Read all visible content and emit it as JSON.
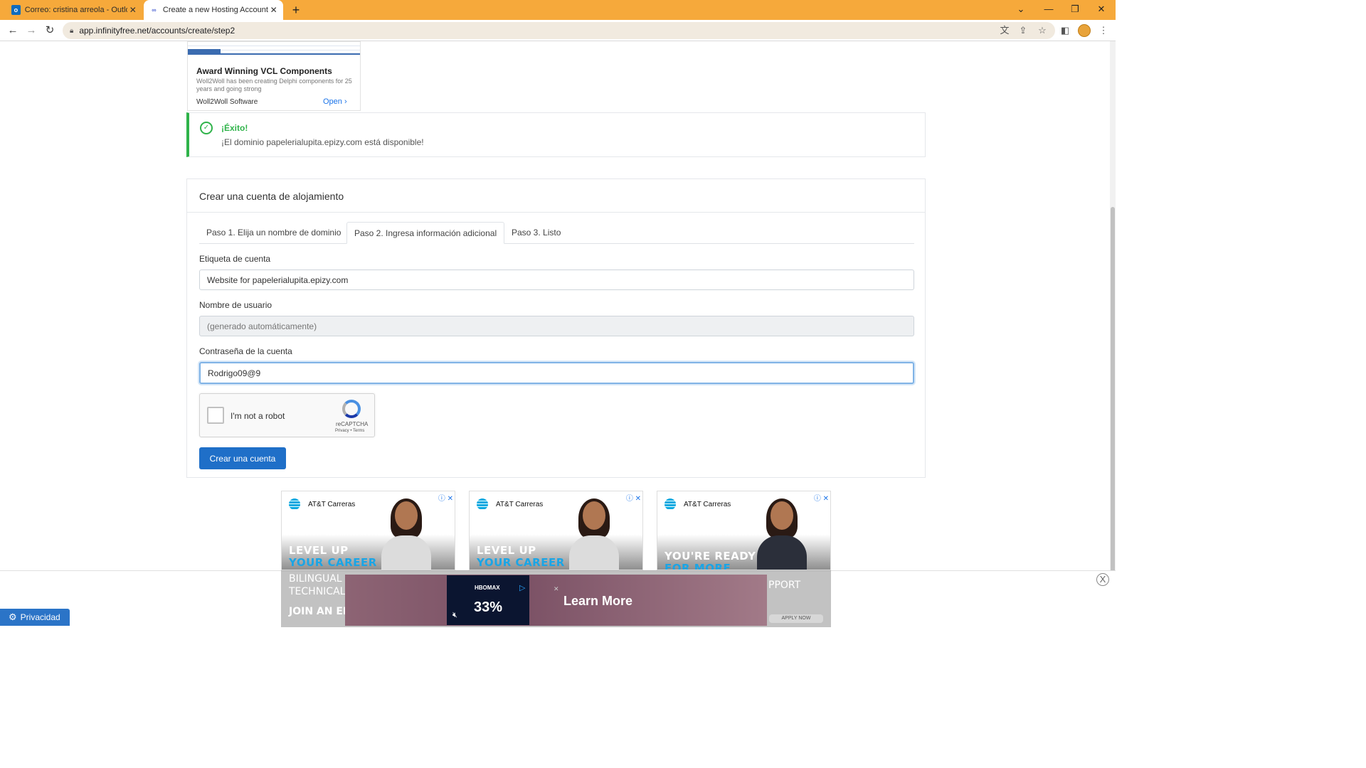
{
  "browser": {
    "tabs": [
      {
        "title": "Correo: cristina arreola - Outlook",
        "icon": "outlook-icon",
        "active": false
      },
      {
        "title": "Create a new Hosting Account - I",
        "icon": "infinityfree-icon",
        "active": true
      }
    ],
    "url": "app.infinityfree.net/accounts/create/step2",
    "accent_color": "#f6a93b"
  },
  "top_ad": {
    "title": "Award Winning VCL Components",
    "description": "Woll2Woll has been creating Delphi components for 25 years and going strong",
    "brand": "Woll2Woll Software",
    "cta": "Open"
  },
  "alert": {
    "title": "¡Éxito!",
    "message": "¡El dominio papelerialupita.epizy.com está disponible!",
    "color": "#2fb34a"
  },
  "card": {
    "title": "Crear una cuenta de alojamiento",
    "tabs": [
      {
        "label": "Paso 1. Elija un nombre de dominio",
        "active": false
      },
      {
        "label": "Paso 2. Ingresa información adicional",
        "active": true
      },
      {
        "label": "Paso 3. Listo",
        "active": false
      }
    ],
    "fields": {
      "account_label": {
        "label": "Etiqueta de cuenta",
        "value": "Website for papelerialupita.epizy.com"
      },
      "username": {
        "label": "Nombre de usuario",
        "placeholder": "(generado automáticamente)"
      },
      "password": {
        "label": "Contraseña de la cuenta",
        "value": "Rodrigo09@9"
      }
    },
    "captcha": {
      "label": "I'm not a robot",
      "brand": "reCAPTCHA",
      "terms": "Privacy • Terms"
    },
    "submit_label": "Crear una cuenta",
    "primary_color": "#1f6fc8"
  },
  "bottom_ads": [
    {
      "brand": "AT&T Carreras",
      "line1": "LEVEL UP",
      "line2": "YOUR CAREER"
    },
    {
      "brand": "AT&T Carreras",
      "line1": "LEVEL UP",
      "line2": "YOUR CAREER"
    },
    {
      "brand": "AT&T Carreras",
      "line1": "YOU'RE READY",
      "line2": "FOR MORE"
    }
  ],
  "overlay": {
    "ghost_lines": [
      "BILINGUAL",
      "TECHNICAL SU",
      "JOIN AN ELIT",
      "PPORT"
    ],
    "ghost_button": "APPLY NOW",
    "video_brand": "HBOMAX",
    "video_discount": "33%",
    "cta": "Learn More",
    "close": "X"
  },
  "privacy_label": "Privacidad"
}
